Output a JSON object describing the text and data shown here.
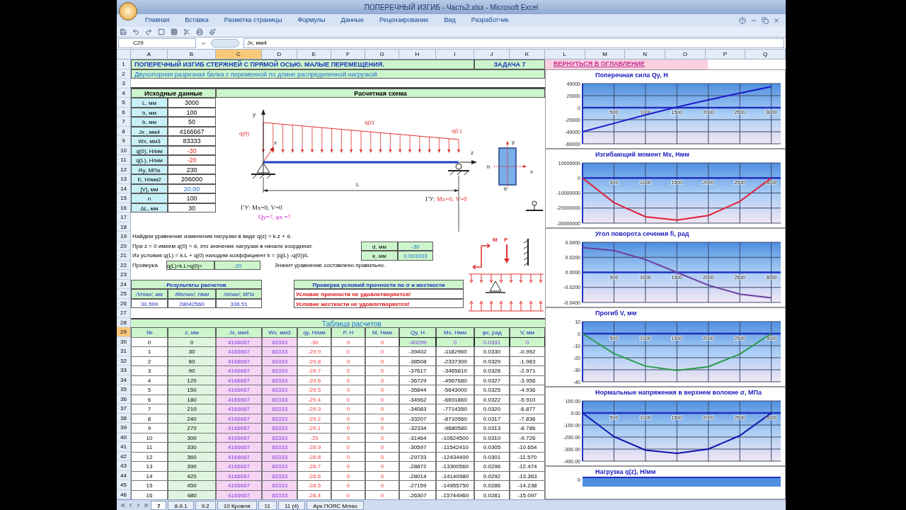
{
  "window": {
    "title": "ПОПЕРЕЧНЫЙ ИЗГИБ - Часть2.xlsx - Microsoft Excel"
  },
  "ribbon_tabs": [
    "Главная",
    "Вставка",
    "Разметка страницы",
    "Формулы",
    "Данные",
    "Рецензирование",
    "Вид",
    "Разработчик"
  ],
  "name_box": "C29",
  "formula": "Jx, мм4",
  "columns": [
    {
      "label": "A",
      "selected": false
    },
    {
      "label": "B",
      "selected": false
    },
    {
      "label": "C",
      "selected": true
    },
    {
      "label": "D",
      "selected": false
    },
    {
      "label": "E",
      "selected": false
    },
    {
      "label": "F",
      "selected": false
    },
    {
      "label": "G",
      "selected": false
    },
    {
      "label": "H",
      "selected": false
    },
    {
      "label": "I",
      "selected": false
    },
    {
      "label": "J",
      "selected": false
    },
    {
      "label": "K",
      "selected": false
    },
    {
      "label": "L",
      "selected": false
    },
    {
      "label": "M",
      "selected": false
    },
    {
      "label": "N",
      "selected": false
    },
    {
      "label": "O",
      "selected": false
    },
    {
      "label": "P",
      "selected": false
    },
    {
      "label": "Q",
      "selected": false
    }
  ],
  "rows": [
    {
      "label": "1",
      "selected": false
    },
    {
      "label": "2",
      "selected": false
    },
    {
      "label": "3",
      "selected": false
    },
    {
      "label": "4",
      "selected": false
    },
    {
      "label": "5",
      "selected": false
    },
    {
      "label": "6",
      "selected": false
    },
    {
      "label": "7",
      "selected": false
    },
    {
      "label": "8",
      "selected": false
    },
    {
      "label": "9",
      "selected": false
    },
    {
      "label": "10",
      "selected": false
    },
    {
      "label": "11",
      "selected": false
    },
    {
      "label": "12",
      "selected": false
    },
    {
      "label": "13",
      "selected": false
    },
    {
      "label": "14",
      "selected": false
    },
    {
      "label": "15",
      "selected": false
    },
    {
      "label": "16",
      "selected": false
    },
    {
      "label": "17",
      "selected": false
    },
    {
      "label": "18",
      "selected": false
    },
    {
      "label": "19",
      "selected": false
    },
    {
      "label": "20",
      "selected": false
    },
    {
      "label": "21",
      "selected": false
    },
    {
      "label": "22",
      "selected": false
    },
    {
      "label": "23",
      "selected": false
    },
    {
      "label": "24",
      "selected": false
    },
    {
      "label": "25",
      "selected": false
    },
    {
      "label": "26",
      "selected": false
    },
    {
      "label": "27",
      "selected": false
    },
    {
      "label": "28",
      "selected": false
    },
    {
      "label": "29",
      "selected": true
    },
    {
      "label": "30",
      "selected": false
    },
    {
      "label": "31",
      "selected": false
    },
    {
      "label": "32",
      "selected": false
    },
    {
      "label": "33",
      "selected": false
    },
    {
      "label": "34",
      "selected": false
    },
    {
      "label": "35",
      "selected": false
    },
    {
      "label": "36",
      "selected": false
    },
    {
      "label": "37",
      "selected": false
    },
    {
      "label": "38",
      "selected": false
    },
    {
      "label": "39",
      "selected": false
    },
    {
      "label": "40",
      "selected": false
    },
    {
      "label": "41",
      "selected": false
    },
    {
      "label": "42",
      "selected": false
    },
    {
      "label": "43",
      "selected": false
    },
    {
      "label": "44",
      "selected": false
    },
    {
      "label": "45",
      "selected": false
    },
    {
      "label": "46",
      "selected": false
    }
  ],
  "header": {
    "title": "ПОПЕРЕЧНЫЙ ИЗГИБ СТЕРЖНЕЙ С ПРЯМОЙ ОСЬЮ. МАЛЫЕ ПЕРЕМЕЩЕНИЯ.",
    "task": "ЗАДАЧА 7",
    "back_link": "ВЕРНУТЬСЯ В ОГЛАВЛЕНИЕ",
    "subtitle": "Двухопорная разрезная балка с переменной по длине распределенной нагрузкой"
  },
  "inputs": {
    "title": "Исходные данные",
    "rows": [
      {
        "label": "L, мм",
        "value": "3000",
        "kind": "plain"
      },
      {
        "label": "h, мм",
        "value": "100",
        "kind": "plain"
      },
      {
        "label": "b, мм",
        "value": "50",
        "kind": "plain"
      },
      {
        "label": "Jx , мм4",
        "value": "4166667",
        "kind": "plain"
      },
      {
        "label": "Wx, мм3",
        "value": "83333",
        "kind": "plain"
      },
      {
        "label": "q(0), Н/мм",
        "value": "-30",
        "kind": "load"
      },
      {
        "label": "q(L), Н/мм",
        "value": "-20",
        "kind": "load"
      },
      {
        "label": "Ry, МПа",
        "value": "230",
        "kind": "plain"
      },
      {
        "label": "E, Н/мм2",
        "value": "206000",
        "kind": "plain"
      },
      {
        "label": "[V], мм",
        "value": "20.00",
        "kind": "limit"
      },
      {
        "label": "n",
        "value": "100",
        "kind": "plain"
      },
      {
        "label": "ΔL, мм",
        "value": "30",
        "kind": "plain"
      }
    ]
  },
  "scheme": {
    "title": "Расчетная схема",
    "y_axis": "y",
    "z_axis": "z",
    "x_axis": "x",
    "q0": "q(0)",
    "qz": "q(z)",
    "qL": "q(L)",
    "span": "L",
    "section_y": "y",
    "section_h": "h",
    "section_x": "x",
    "section_b": "b",
    "bc_left": "ГУ: Mx=0, V=0",
    "bc_right_prefix": "ГУ:",
    "bc_right": "Mx=0, V=0",
    "unknowns": "Qy=?, φx =?"
  },
  "derivation": {
    "lines": [
      "Найдем уравнение изменения нагрузки в виде q(z) = k.z + d.",
      "При z = 0 имеем q(0) = d, это значение нагрузки в начале координат.",
      "Из условия q(L) =  k.L + q(0)  находим коэффициент k = (q(L) -q(0))/L"
    ],
    "check_label": "Проверка",
    "check_formula": "q(L)=k.L+q(0)=",
    "check_value": "-20",
    "check_note": "Значит уравнение составлено правильно.",
    "coefficients": [
      {
        "label": "d, мм",
        "value": "-30"
      },
      {
        "label": "k, мм",
        "value": "0.003333"
      }
    ]
  },
  "legend_drawing": {
    "moment": "M",
    "force": "P"
  },
  "results": {
    "title": "Результаты расчетов",
    "columns": [
      "/Vmax/, мм",
      "/Mxmax/, Нмм",
      "/σmax/, МПа"
    ],
    "values": [
      "30.599",
      "28042560",
      "336.51"
    ]
  },
  "checks": {
    "title": "Проверка условий прочности по σ и жесткости",
    "messages": [
      "Условие прочности не удовлетворяется!",
      "Условие жесткости не удовлетворяется!"
    ]
  },
  "table": {
    "title": "Таблица расчетов",
    "columns": [
      "№",
      "z, мм",
      "Jx, мм4",
      "Wx, мм3",
      "qy, Н/мм",
      "P, Н",
      "M, Нмм",
      "Qy, Н",
      "Mx, Нмм",
      "φx, рад",
      "V, мм"
    ],
    "rows": [
      {
        "kind": "boundary",
        "cells": [
          "0",
          "0",
          "4166667",
          "83333",
          "-30",
          "0",
          "0",
          "-40299",
          "0",
          "0.0331",
          "0"
        ]
      },
      {
        "kind": "regular",
        "cells": [
          "1",
          "30",
          "4166667",
          "83333",
          "-29.9",
          "0",
          "0",
          "-39402",
          "-1182960",
          "0.0330",
          "-0.992"
        ]
      },
      {
        "kind": "regular",
        "cells": [
          "2",
          "60",
          "4166667",
          "83333",
          "-29.8",
          "0",
          "0",
          "-38508",
          "-2337300",
          "0.0329",
          "-1.983"
        ]
      },
      {
        "kind": "regular",
        "cells": [
          "3",
          "90",
          "4166667",
          "83333",
          "-29.7",
          "0",
          "0",
          "-37617",
          "-3465810",
          "0.0328",
          "-2.971"
        ]
      },
      {
        "kind": "regular",
        "cells": [
          "4",
          "120",
          "4166667",
          "83333",
          "-29.6",
          "0",
          "0",
          "-36729",
          "-4567680",
          "0.0327",
          "-3.956"
        ]
      },
      {
        "kind": "regular",
        "cells": [
          "5",
          "150",
          "4166667",
          "83333",
          "-29.5",
          "0",
          "0",
          "-35844",
          "-5643000",
          "0.0325",
          "-4.936"
        ]
      },
      {
        "kind": "regular",
        "cells": [
          "6",
          "180",
          "4166667",
          "83333",
          "-29.4",
          "0",
          "0",
          "-34962",
          "-6691860",
          "0.0322",
          "-5.910"
        ]
      },
      {
        "kind": "regular",
        "cells": [
          "7",
          "210",
          "4166667",
          "83333",
          "-29.3",
          "0",
          "0",
          "-34083",
          "-7714350",
          "0.0320",
          "-6.877"
        ]
      },
      {
        "kind": "regular",
        "cells": [
          "8",
          "240",
          "4166667",
          "83333",
          "-29.2",
          "0",
          "0",
          "-33207",
          "-8710560",
          "0.0317",
          "-7.836"
        ]
      },
      {
        "kind": "regular",
        "cells": [
          "9",
          "270",
          "4166667",
          "83333",
          "-29.1",
          "0",
          "0",
          "-32334",
          "-9680580",
          "0.0313",
          "-8.786"
        ]
      },
      {
        "kind": "regular",
        "cells": [
          "10",
          "300",
          "4166667",
          "83333",
          "-29",
          "0",
          "0",
          "-31464",
          "-10624500",
          "0.0310",
          "-9.726"
        ]
      },
      {
        "kind": "regular",
        "cells": [
          "11",
          "330",
          "4166667",
          "83333",
          "-28.9",
          "0",
          "0",
          "-30597",
          "-11542410",
          "0.0305",
          "-10.654"
        ]
      },
      {
        "kind": "regular",
        "cells": [
          "12",
          "360",
          "4166667",
          "83333",
          "-28.8",
          "0",
          "0",
          "-29733",
          "-12434400",
          "0.0301",
          "-11.570"
        ]
      },
      {
        "kind": "regular",
        "cells": [
          "13",
          "390",
          "4166667",
          "83333",
          "-28.7",
          "0",
          "0",
          "-28872",
          "-13300560",
          "0.0296",
          "-12.474"
        ]
      },
      {
        "kind": "regular",
        "cells": [
          "14",
          "420",
          "4166667",
          "83333",
          "-28.6",
          "0",
          "0",
          "-28014",
          "-14140980",
          "0.0292",
          "-13.363"
        ]
      },
      {
        "kind": "regular",
        "cells": [
          "15",
          "450",
          "4166667",
          "83333",
          "-28.5",
          "0",
          "0",
          "-27159",
          "-14955750",
          "0.0286",
          "-14.238"
        ]
      },
      {
        "kind": "regular",
        "cells": [
          "16",
          "480",
          "4166667",
          "83333",
          "-28.4",
          "0",
          "0",
          "-26307",
          "-15744960",
          "0.0281",
          "-15.097"
        ]
      }
    ]
  },
  "charts": [
    {
      "chart_data": {
        "type": "line",
        "title": "Поперечная сила Qy, Н",
        "x": [
          0,
          500,
          1000,
          1500,
          2000,
          2500,
          3000
        ],
        "xlim": [
          0,
          3150
        ],
        "ylim": [
          -60000,
          40000
        ],
        "xticks": [
          {
            "value": 500,
            "label": "500"
          },
          {
            "value": 1000,
            "label": "1000"
          },
          {
            "value": 1500,
            "label": "1500"
          },
          {
            "value": 2000,
            "label": "2000"
          },
          {
            "value": 2500,
            "label": "2500"
          },
          {
            "value": 3000,
            "label": "3000"
          }
        ],
        "yticks": [
          {
            "value": 40000,
            "label": "40000"
          },
          {
            "value": 20000,
            "label": "20000"
          },
          {
            "value": 0,
            "label": "0"
          },
          {
            "value": -20000,
            "label": "-20000"
          },
          {
            "value": -40000,
            "label": "-40000"
          },
          {
            "value": -60000,
            "label": "-60000"
          }
        ],
        "series": [
          {
            "color": "#1a1acc",
            "values": [
              -40000,
              -26000,
              -12000,
              1000,
              13000,
              24000,
              35000
            ]
          }
        ],
        "grid": true
      }
    },
    {
      "chart_data": {
        "type": "line",
        "title": "Изгибающий момент Mx, Нмм",
        "x": [
          0,
          500,
          1000,
          1500,
          2000,
          2500,
          3000
        ],
        "xlim": [
          0,
          3150
        ],
        "ylim": [
          -30000000,
          10000000
        ],
        "xticks": [
          {
            "value": 500,
            "label": "500"
          },
          {
            "value": 1000,
            "label": "1000"
          },
          {
            "value": 1500,
            "label": "1500"
          },
          {
            "value": 2000,
            "label": "2000"
          },
          {
            "value": 2500,
            "label": "2500"
          },
          {
            "value": 3000,
            "label": "3000"
          }
        ],
        "yticks": [
          {
            "value": 10000000,
            "label": "10000000"
          },
          {
            "value": 0,
            "label": "0"
          },
          {
            "value": -10000000,
            "label": "-10000000"
          },
          {
            "value": -20000000,
            "label": "-20000000"
          },
          {
            "value": -30000000,
            "label": "-30000000"
          }
        ],
        "series": [
          {
            "color": "#e0203a",
            "values": [
              0,
              -16400000,
              -25700000,
              -28000000,
              -24900000,
              -15600000,
              0
            ]
          }
        ],
        "grid": true
      }
    },
    {
      "chart_data": {
        "type": "line",
        "title": "Угол поворота сечения fi, рад",
        "x": [
          0,
          500,
          1000,
          1500,
          2000,
          2500,
          3000
        ],
        "xlim": [
          0,
          3150
        ],
        "ylim": [
          -0.04,
          0.04
        ],
        "xticks": [
          {
            "value": 500,
            "label": "500"
          },
          {
            "value": 1000,
            "label": "1000"
          },
          {
            "value": 1500,
            "label": "1500"
          },
          {
            "value": 2000,
            "label": "2000"
          },
          {
            "value": 2500,
            "label": "2500"
          },
          {
            "value": 3000,
            "label": "3000"
          }
        ],
        "yticks": [
          {
            "value": 0.04,
            "label": "0.0400"
          },
          {
            "value": 0.02,
            "label": "0.0200"
          },
          {
            "value": 0,
            "label": "0.0000"
          },
          {
            "value": -0.02,
            "label": "-0.0200"
          },
          {
            "value": -0.04,
            "label": "-0.0400"
          }
        ],
        "series": [
          {
            "color": "#6a3fa0",
            "values": [
              0.033,
              0.029,
              0.017,
              0.0,
              -0.017,
              -0.029,
              -0.034
            ]
          }
        ],
        "grid": true
      }
    },
    {
      "chart_data": {
        "type": "line",
        "title": "Прогиб V, мм",
        "x": [
          0,
          500,
          1000,
          1500,
          2000,
          2500,
          3000
        ],
        "xlim": [
          0,
          3150
        ],
        "ylim": [
          -40,
          10
        ],
        "xticks": [
          {
            "value": 500,
            "label": "500"
          },
          {
            "value": 1000,
            "label": "1000"
          },
          {
            "value": 1500,
            "label": "1500"
          },
          {
            "value": 2000,
            "label": "2000"
          },
          {
            "value": 2500,
            "label": "2500"
          },
          {
            "value": 3000,
            "label": "3000"
          }
        ],
        "yticks": [
          {
            "value": 10,
            "label": "10"
          },
          {
            "value": 0,
            "label": "0"
          },
          {
            "value": -10,
            "label": "-10"
          },
          {
            "value": -20,
            "label": "-20"
          },
          {
            "value": -30,
            "label": "-30"
          },
          {
            "value": -40,
            "label": "-40"
          }
        ],
        "series": [
          {
            "color": "#2a9a4a",
            "values": [
              0,
              -16.5,
              -27,
              -30.6,
              -27.5,
              -17,
              0
            ]
          }
        ],
        "grid": true
      }
    },
    {
      "chart_data": {
        "type": "line",
        "title": "Нормальные напряжения в верхнем волокне σ, МПа",
        "x": [
          0,
          500,
          1000,
          1500,
          2000,
          2500,
          3000
        ],
        "xlim": [
          0,
          3150
        ],
        "ylim": [
          -400,
          100
        ],
        "xticks": [
          {
            "value": 500,
            "label": "500"
          },
          {
            "value": 1000,
            "label": "1000"
          },
          {
            "value": 1500,
            "label": "1500"
          },
          {
            "value": 2000,
            "label": "2000"
          },
          {
            "value": 2500,
            "label": "2500"
          },
          {
            "value": 3000,
            "label": "3000"
          }
        ],
        "yticks": [
          {
            "value": 100,
            "label": "100.00"
          },
          {
            "value": 0,
            "label": "0.00"
          },
          {
            "value": -100,
            "label": "-100.00"
          },
          {
            "value": -200,
            "label": "-200.00"
          },
          {
            "value": -300,
            "label": "-300.00"
          },
          {
            "value": -400,
            "label": "-400.00"
          }
        ],
        "series": [
          {
            "color": "#1010b0",
            "values": [
              0,
              -197,
              -309,
              -336,
              -300,
              -188,
              0
            ]
          }
        ],
        "grid": true
      }
    }
  ],
  "load_chart": {
    "title": "Нагрузка q(z), Н/мм",
    "tick": "0"
  },
  "sheet_tabs": [
    {
      "label": "7",
      "selected": true
    },
    {
      "label": "8-9.1",
      "selected": false
    },
    {
      "label": "9.2",
      "selected": false
    },
    {
      "label": "10 Кровля",
      "selected": false
    },
    {
      "label": "11",
      "selected": false
    },
    {
      "label": "11 (4)",
      "selected": false
    },
    {
      "label": "Арк ПОЯС Мmax",
      "selected": false
    }
  ]
}
